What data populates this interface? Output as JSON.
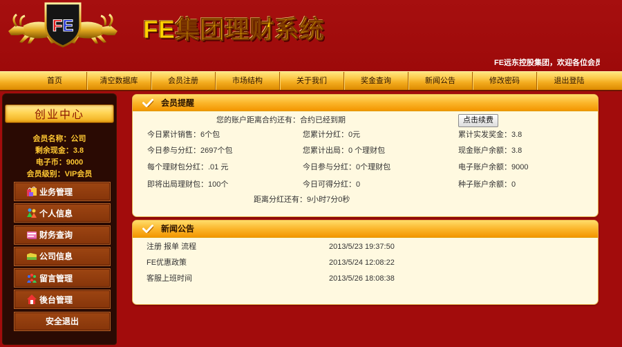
{
  "header": {
    "logo": {
      "letters": [
        "F",
        "E"
      ]
    },
    "title": "FE集团理财系统",
    "marquee": "FE远东控股集团，欢迎各位会员"
  },
  "nav": {
    "items": [
      "首页",
      "清空数据库",
      "会员注册",
      "市场结构",
      "关于我们",
      "奖金查询",
      "新闻公告",
      "修改密码",
      "退出登陆"
    ]
  },
  "sidebar": {
    "title": "创业中心",
    "member_info": [
      {
        "label": "会员名称：",
        "value": "公司"
      },
      {
        "label": "剩余现金：",
        "value": "3.8"
      },
      {
        "label": "电子币：",
        "value": "9000"
      },
      {
        "label": "会员级别：",
        "value": "VIP会员"
      }
    ],
    "menu": [
      {
        "label": "业务管理",
        "icon": "shopping-bags-icon"
      },
      {
        "label": "个人信息",
        "icon": "people-icon"
      },
      {
        "label": "财务查询",
        "icon": "ledger-icon"
      },
      {
        "label": "公司信息",
        "icon": "folder-icon"
      },
      {
        "label": "留言管理",
        "icon": "group-icon"
      },
      {
        "label": "後台管理",
        "icon": "home-icon"
      },
      {
        "label": "安全退出",
        "icon": null
      }
    ]
  },
  "reminder": {
    "title": "会员提醒",
    "icon": "checkmark-icon",
    "contract": {
      "label": "您的账户距离合约还有：",
      "value": "合约已经到期"
    },
    "renew_button": "点击续费",
    "rows": [
      [
        {
          "label": "今日累计销售：",
          "value": "6个包"
        },
        {
          "label": "您累计分红：",
          "value": "0元"
        },
        {
          "label": "累计实发奖金：",
          "value": "3.8"
        }
      ],
      [
        {
          "label": "今日参与分红：",
          "value": "2697个包"
        },
        {
          "label": "您累计出局：",
          "value": "0 个理财包"
        },
        {
          "label": "现金账户余额：",
          "value": "3.8"
        }
      ],
      [
        {
          "label": "每个理财包分红：",
          "value": ".01 元"
        },
        {
          "label": "今日参与分红：",
          "value": "0个理财包"
        },
        {
          "label": "电子账户余额：",
          "value": "9000"
        }
      ],
      [
        {
          "label": "即将出局理财包：",
          "value": "100个"
        },
        {
          "label": "今日可得分红：",
          "value": "0"
        },
        {
          "label": "种子账户余额：",
          "value": "0"
        }
      ]
    ],
    "countdown": {
      "label": "距离分红还有：",
      "value": "9小时7分0秒"
    }
  },
  "news": {
    "title": "新闻公告",
    "icon": "checkmark-icon",
    "items": [
      {
        "title": "注册 报单 流程",
        "date": "2013/5/23 19:37:50"
      },
      {
        "title": "FE优惠政策",
        "date": "2013/5/24 12:08:22"
      },
      {
        "title": "客服上班时间",
        "date": "2013/5/26 18:08:38"
      }
    ]
  },
  "colors": {
    "background": "#a20c0c",
    "nav_gold": "#f3ab1e",
    "title_gold": "#ffd200",
    "sidebar_dark": "#2a0a03",
    "menu_brown": "#8b380c",
    "member_text": "#ffc832",
    "panel_body": "#fff9e0"
  }
}
